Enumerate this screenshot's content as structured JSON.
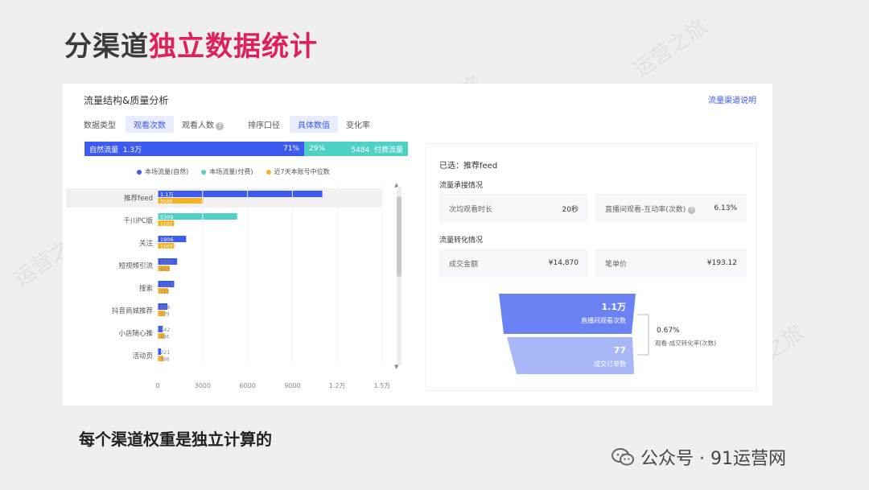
{
  "slide": {
    "title_part1": "分渠道",
    "title_part2": "独立数据统计",
    "subtitle": "每个渠道权重是独立计算的",
    "brand": "公众号 · 91运营网",
    "watermark": "运营之旅"
  },
  "panel": {
    "title": "流量结构&质量分析",
    "help_link": "流量渠道说明",
    "filter": {
      "data_type_label": "数据类型",
      "data_type_options": [
        "观看次数",
        "观看人数"
      ],
      "sort_label": "排序口径",
      "sort_options": [
        "具体数值",
        "变化率"
      ]
    },
    "stack_bar": {
      "organic_label": "自然流量",
      "organic_value": "1.3万",
      "organic_pct": "71%",
      "paid_pct": "29%",
      "paid_value": "5484",
      "paid_label": "付费流量"
    }
  },
  "chart_data": {
    "type": "bar",
    "orientation": "horizontal",
    "legend": [
      "本场流量(自然)",
      "本场流量(付费)",
      "近7天本账号中位数"
    ],
    "colors": [
      "#3d5af1",
      "#4fd1c5",
      "#f5b324"
    ],
    "categories": [
      "推荐feed",
      "千川PC版",
      "关注",
      "短视频引流",
      "搜索",
      "抖音商城推荐",
      "小店随心推",
      "活动页"
    ],
    "series": [
      {
        "name": "本场流量(自然)",
        "values": [
          11000,
          0,
          1900,
          1300,
          1100,
          650,
          340,
          220
        ]
      },
      {
        "name": "本场流量(付费)",
        "values": [
          0,
          5309,
          0,
          0,
          0,
          0,
          0,
          0
        ]
      },
      {
        "name": "近7天本账号中位数",
        "values": [
          3046,
          1101,
          1100,
          800,
          700,
          500,
          450,
          380
        ]
      }
    ],
    "bar_labels": [
      [
        "1.1万",
        "3046"
      ],
      [
        "5309",
        "1101"
      ],
      [
        "1906",
        "1103"
      ],
      [
        "1307",
        "843"
      ],
      [
        "1115",
        "722"
      ],
      [
        "658",
        "579"
      ],
      [
        "342",
        "486"
      ],
      [
        "221",
        "388"
      ]
    ],
    "x_ticks": [
      "0",
      "3000",
      "6000",
      "9000",
      "1.2万",
      "1.5万"
    ],
    "xlim": [
      0,
      15000
    ]
  },
  "detail": {
    "selected": "已选：推荐feed",
    "section1": "流量承接情况",
    "section2": "流量转化情况",
    "metrics": [
      {
        "label": "次均观看时长",
        "value": "20秒"
      },
      {
        "label": "直播间观看-互动率(次数)",
        "value": "6.13%"
      },
      {
        "label": "成交金额",
        "value": "¥14,870"
      },
      {
        "label": "笔单价",
        "value": "¥193.12"
      }
    ],
    "funnel": {
      "top_value": "1.1万",
      "top_label": "直播间观看次数",
      "bottom_value": "77",
      "bottom_label": "成交订单数",
      "rate": "0.67%",
      "rate_label": "观看-成交转化率(次数)"
    }
  }
}
